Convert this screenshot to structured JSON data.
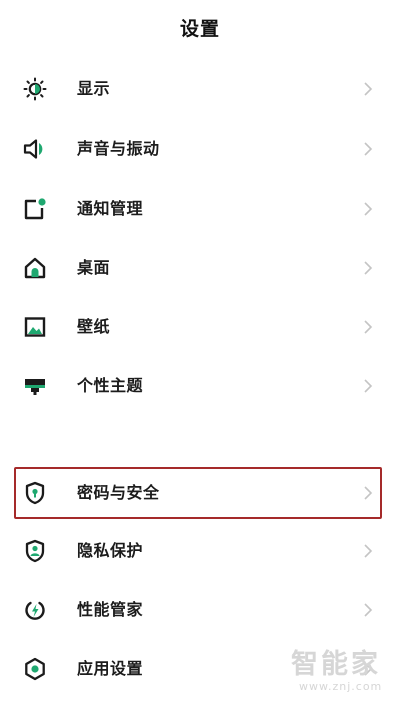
{
  "header": {
    "title": "设置"
  },
  "items": [
    {
      "label": "显示",
      "icon": "brightness-icon"
    },
    {
      "label": "声音与振动",
      "icon": "speaker-icon"
    },
    {
      "label": "通知管理",
      "icon": "notification-icon"
    },
    {
      "label": "桌面",
      "icon": "home-icon"
    },
    {
      "label": "壁纸",
      "icon": "wallpaper-icon"
    },
    {
      "label": "个性主题",
      "icon": "theme-icon"
    },
    {
      "label": "密码与安全",
      "icon": "shield-lock-icon"
    },
    {
      "label": "隐私保护",
      "icon": "privacy-icon"
    },
    {
      "label": "性能管家",
      "icon": "performance-icon"
    },
    {
      "label": "应用设置",
      "icon": "app-settings-icon"
    }
  ],
  "watermark": {
    "brand": "智能家",
    "url": "www.znj.com"
  },
  "colors": {
    "accent": "#1fa870",
    "icon_dark": "#1b1b1b",
    "highlight_border": "#a52a2a",
    "chevron": "#c4c4c4"
  }
}
